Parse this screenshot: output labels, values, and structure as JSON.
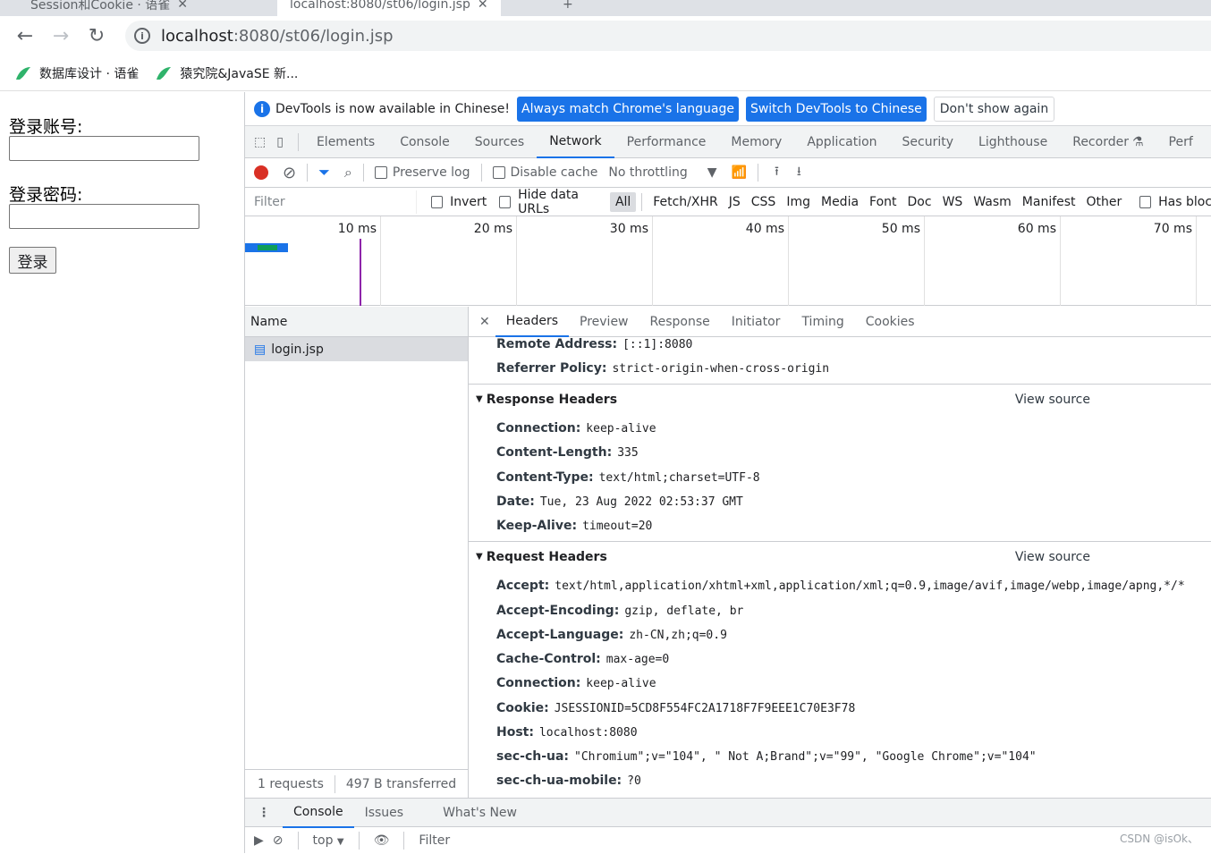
{
  "browser": {
    "tabs": [
      {
        "title": "Session和Cookie · 语雀"
      },
      {
        "title": "localhost:8080/st06/login.jsp"
      }
    ],
    "url_host": "localhost",
    "url_rest": ":8080/st06/login.jsp",
    "bookmarks": [
      {
        "label": "数据库设计 · 语雀"
      },
      {
        "label": "猿究院&JavaSE 新..."
      }
    ]
  },
  "page": {
    "account_label": "登录账号:",
    "password_label": "登录密码:",
    "login_button": "登录"
  },
  "devtools": {
    "infobar": {
      "message": "DevTools is now available in Chinese!",
      "btn_match": "Always match Chrome's language",
      "btn_switch": "Switch DevTools to Chinese",
      "btn_dismiss": "Don't show again"
    },
    "tabs": [
      "Elements",
      "Console",
      "Sources",
      "Network",
      "Performance",
      "Memory",
      "Application",
      "Security",
      "Lighthouse",
      "Recorder",
      "Perf"
    ],
    "controls": {
      "preserve_log": "Preserve log",
      "disable_cache": "Disable cache",
      "throttling": "No throttling"
    },
    "filter": {
      "placeholder": "Filter",
      "invert": "Invert",
      "hide_data_urls": "Hide data URLs",
      "types": [
        "All",
        "Fetch/XHR",
        "JS",
        "CSS",
        "Img",
        "Media",
        "Font",
        "Doc",
        "WS",
        "Wasm",
        "Manifest",
        "Other"
      ],
      "has_blocked": "Has bloc"
    },
    "timeline_ticks": [
      "10 ms",
      "20 ms",
      "30 ms",
      "40 ms",
      "50 ms",
      "60 ms",
      "70 ms"
    ],
    "name_header": "Name",
    "requests": [
      {
        "name": "login.jsp"
      }
    ],
    "status": {
      "requests": "1 requests",
      "transferred": "497 B transferred"
    },
    "detail_tabs": [
      "Headers",
      "Preview",
      "Response",
      "Initiator",
      "Timing",
      "Cookies"
    ],
    "general_tail": [
      {
        "k": "Remote Address:",
        "v": "[::1]:8080"
      },
      {
        "k": "Referrer Policy:",
        "v": "strict-origin-when-cross-origin"
      }
    ],
    "response_headers_title": "Response Headers",
    "request_headers_title": "Request Headers",
    "view_source": "View source",
    "response_headers": [
      {
        "k": "Connection:",
        "v": "keep-alive"
      },
      {
        "k": "Content-Length:",
        "v": "335"
      },
      {
        "k": "Content-Type:",
        "v": "text/html;charset=UTF-8"
      },
      {
        "k": "Date:",
        "v": "Tue, 23 Aug 2022 02:53:37 GMT"
      },
      {
        "k": "Keep-Alive:",
        "v": "timeout=20"
      }
    ],
    "request_headers": [
      {
        "k": "Accept:",
        "v": "text/html,application/xhtml+xml,application/xml;q=0.9,image/avif,image/webp,image/apng,*/*"
      },
      {
        "k": "Accept-Encoding:",
        "v": "gzip, deflate, br"
      },
      {
        "k": "Accept-Language:",
        "v": "zh-CN,zh;q=0.9"
      },
      {
        "k": "Cache-Control:",
        "v": "max-age=0"
      },
      {
        "k": "Connection:",
        "v": "keep-alive"
      },
      {
        "k": "Cookie:",
        "v": "JSESSIONID=5CD8F554FC2A1718F7F9EEE1C70E3F78"
      },
      {
        "k": "Host:",
        "v": "localhost:8080"
      },
      {
        "k": "sec-ch-ua:",
        "v": "\"Chromium\";v=\"104\", \" Not A;Brand\";v=\"99\", \"Google Chrome\";v=\"104\""
      },
      {
        "k": "sec-ch-ua-mobile:",
        "v": "?0"
      }
    ],
    "drawer_tabs": [
      "Console",
      "Issues",
      "What's New"
    ],
    "drawer_context": "top",
    "drawer_filter": "Filter"
  },
  "watermark": "CSDN @isOk、",
  "colors": {
    "accent": "#1a73e8",
    "record": "#d93025"
  }
}
